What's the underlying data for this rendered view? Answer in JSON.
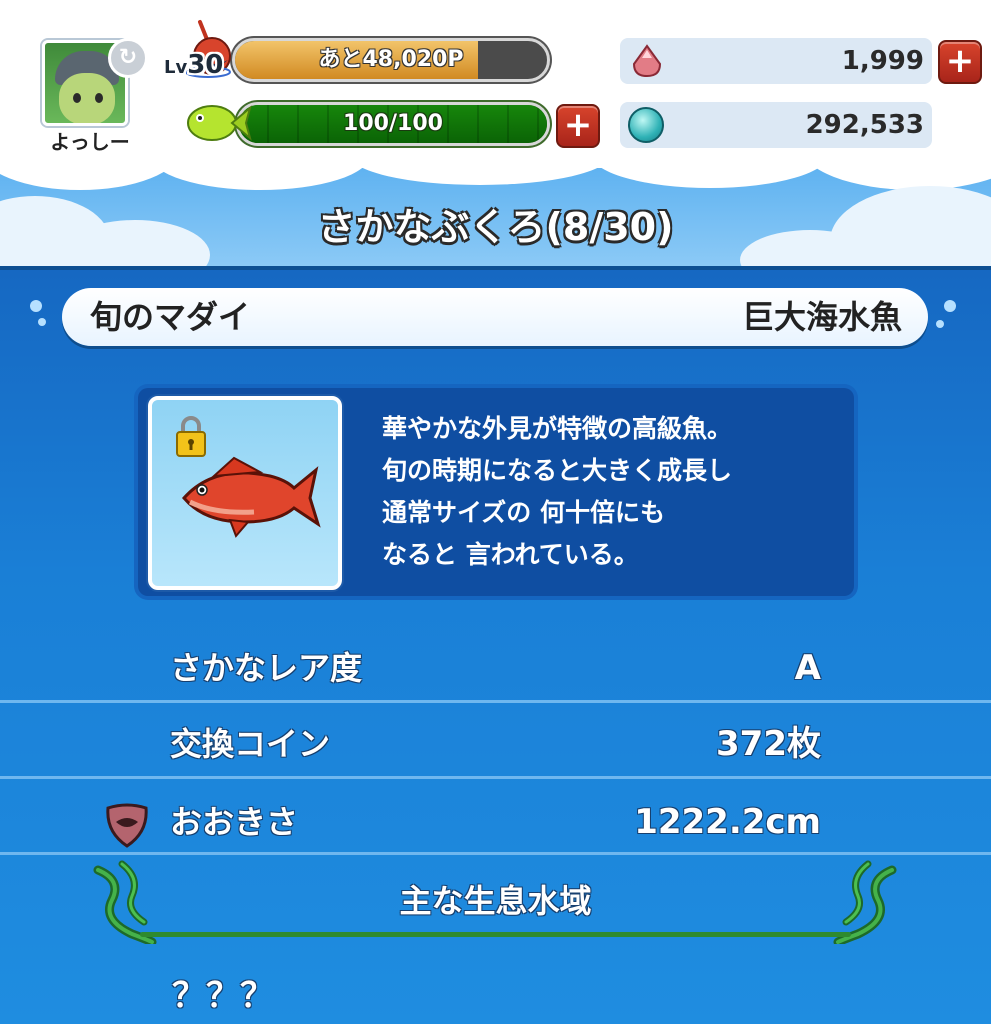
{
  "player": {
    "name": "よっしー",
    "level_prefix": "Lv",
    "level": "30",
    "exp_text": "あと48,020P",
    "exp_progress": 0.78,
    "stamina_text": "100/100",
    "stamina_progress": 1.0
  },
  "currency": {
    "gems": "1,999",
    "coins": "292,533"
  },
  "page": {
    "title": "さかなぶくろ(8/30)"
  },
  "fish": {
    "name": "旬のマダイ",
    "category": "巨大海水魚",
    "description_lines": [
      "華やかな外見が特徴の高級魚。",
      "旬の時期になると大きく成長し",
      "通常サイズの 何十倍にも",
      "なると 言われている。"
    ],
    "stats": [
      {
        "label": "さかなレア度",
        "value": "A"
      },
      {
        "label": "交換コイン",
        "value": "372枚"
      },
      {
        "label": "おおきさ",
        "value": "1222.2cm"
      }
    ],
    "habitat_title": "主な生息水域",
    "habitat_value": "？？？"
  },
  "icons": {
    "plus": "+",
    "refresh": "↻"
  },
  "colors": {
    "panel_blue": "#1a7fd6",
    "plus_red": "#c0331f",
    "stamina_green": "#3aa52a",
    "exp_orange": "#d18a22"
  }
}
